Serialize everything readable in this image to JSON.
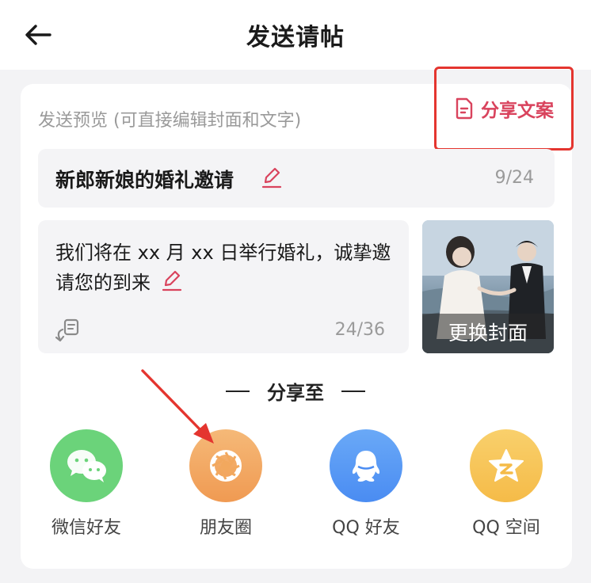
{
  "header": {
    "title": "发送请帖",
    "back_icon": "arrow-left-icon"
  },
  "preview": {
    "label": "发送预览 (可直接编辑封面和文字)",
    "share_copy_label": "分享文案",
    "share_copy_icon": "document-icon",
    "accent_color": "#d9435d",
    "highlight_color": "#e4352f"
  },
  "invite_title": {
    "text": "新郎新娘的婚礼邀请",
    "count": "9/24",
    "edit_icon": "pencil-icon"
  },
  "invite_message": {
    "text": "我们将在 xx 月 xx 日举行婚礼，诚挚邀请您的到来",
    "count": "24/36",
    "template_icon": "template-swap-icon"
  },
  "cover": {
    "button_label": "更换封面"
  },
  "share": {
    "heading": "分享至",
    "targets": [
      {
        "label": "微信好友",
        "icon": "wechat-icon",
        "color": "#6bd37a"
      },
      {
        "label": "朋友圈",
        "icon": "moments-icon",
        "color": "#f2a85e"
      },
      {
        "label": "QQ 好友",
        "icon": "qq-icon",
        "color": "#5b9ef5"
      },
      {
        "label": "QQ 空间",
        "icon": "qzone-icon",
        "color": "#f7c65a"
      }
    ]
  }
}
